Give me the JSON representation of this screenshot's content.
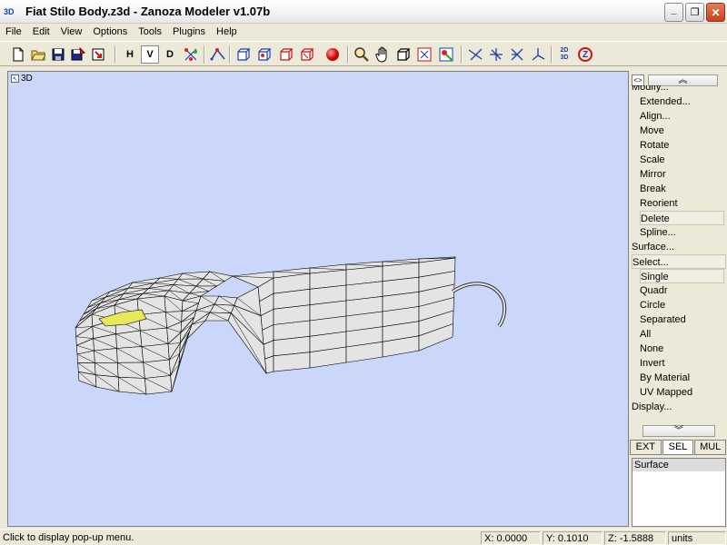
{
  "window": {
    "icon_text": "3D",
    "title": "Fiat Stilo Body.z3d - Zanoza Modeler v1.07b",
    "min_glyph": "_",
    "max_glyph": "❐",
    "close_glyph": "✕"
  },
  "menu": [
    "File",
    "Edit",
    "View",
    "Options",
    "Tools",
    "Plugins",
    "Help"
  ],
  "toolbar": {
    "buttons": [
      {
        "name": "new-file-icon",
        "glyph": "🗋"
      },
      {
        "name": "open-folder-icon",
        "glyph": "📂"
      },
      {
        "name": "save-icon",
        "glyph": "💾"
      },
      {
        "name": "save-as-icon",
        "glyph": "🖫"
      },
      {
        "name": "import-icon",
        "glyph": "⇲"
      },
      {
        "name": "view-h-button",
        "text": "H"
      },
      {
        "name": "view-v-button",
        "text": "V"
      },
      {
        "name": "view-d-button",
        "text": "D"
      },
      {
        "name": "points-icon",
        "glyph": "⁂"
      },
      {
        "name": "edges-icon",
        "glyph": "⌁"
      },
      {
        "name": "box-icon",
        "glyph": "▣"
      },
      {
        "name": "box-select-icon",
        "glyph": "▢"
      },
      {
        "name": "cube-icon",
        "glyph": "⬚"
      },
      {
        "name": "cube-select-icon",
        "glyph": "⬚"
      },
      {
        "name": "sphere-icon",
        "glyph": "●"
      },
      {
        "name": "zoom-icon",
        "glyph": "🔍"
      },
      {
        "name": "pan-hand-icon",
        "glyph": "✋"
      },
      {
        "name": "rotate-cube-icon",
        "glyph": "◫"
      },
      {
        "name": "zoom-extents-icon",
        "glyph": "⊞"
      },
      {
        "name": "camera-icon",
        "glyph": "⊡"
      },
      {
        "name": "axis-1-icon",
        "glyph": "✕"
      },
      {
        "name": "axis-2-icon",
        "glyph": "✛"
      },
      {
        "name": "axis-3-icon",
        "glyph": "✕"
      },
      {
        "name": "axis-4-icon",
        "glyph": "⅄"
      },
      {
        "name": "2d-3d-toggle",
        "text": "2D\n3D"
      },
      {
        "name": "z-icon",
        "text": "Z"
      }
    ]
  },
  "viewport": {
    "label": "3D",
    "background": "#cbd6fb"
  },
  "panel": {
    "toggle_glyph": "<>",
    "scroll_up_glyph": "︽",
    "scroll_down_glyph": "︾",
    "commands": [
      {
        "label": "Modify...",
        "level": "top",
        "partial": true
      },
      {
        "label": "Extended...",
        "level": "sub"
      },
      {
        "label": "Align...",
        "level": "sub"
      },
      {
        "label": "Move",
        "level": "sub"
      },
      {
        "label": "Rotate",
        "level": "sub"
      },
      {
        "label": "Scale",
        "level": "sub"
      },
      {
        "label": "Mirror",
        "level": "sub"
      },
      {
        "label": "Break",
        "level": "sub"
      },
      {
        "label": "Reorient",
        "level": "sub"
      },
      {
        "label": "Delete",
        "level": "sub",
        "boxed": true
      },
      {
        "label": "Spline...",
        "level": "sub"
      },
      {
        "label": "Surface...",
        "level": "top"
      },
      {
        "label": "Select...",
        "level": "top",
        "boxed": true
      },
      {
        "label": "Single",
        "level": "sub",
        "boxed": true
      },
      {
        "label": "Quadr",
        "level": "sub"
      },
      {
        "label": "Circle",
        "level": "sub"
      },
      {
        "label": "Separated",
        "level": "sub"
      },
      {
        "label": "All",
        "level": "sub"
      },
      {
        "label": "None",
        "level": "sub"
      },
      {
        "label": "Invert",
        "level": "sub"
      },
      {
        "label": "By Material",
        "level": "sub"
      },
      {
        "label": "UV Mapped",
        "level": "sub"
      },
      {
        "label": "Display...",
        "level": "top"
      }
    ],
    "modes": [
      {
        "label": "EXT",
        "active": false
      },
      {
        "label": "SEL",
        "active": true
      },
      {
        "label": "MUL",
        "active": false
      }
    ],
    "info_title": "Surface"
  },
  "statusbar": {
    "message": "Click to display pop-up menu.",
    "x": "X: 0.0000",
    "y": "Y: 0.1010",
    "z": "Z: -1.5888",
    "units": "units"
  },
  "colors": {
    "viewport_bg": "#cbd6fb",
    "mesh_fill": "#e4e4e4",
    "mesh_line": "#000000",
    "selection": "#e8e85a"
  }
}
